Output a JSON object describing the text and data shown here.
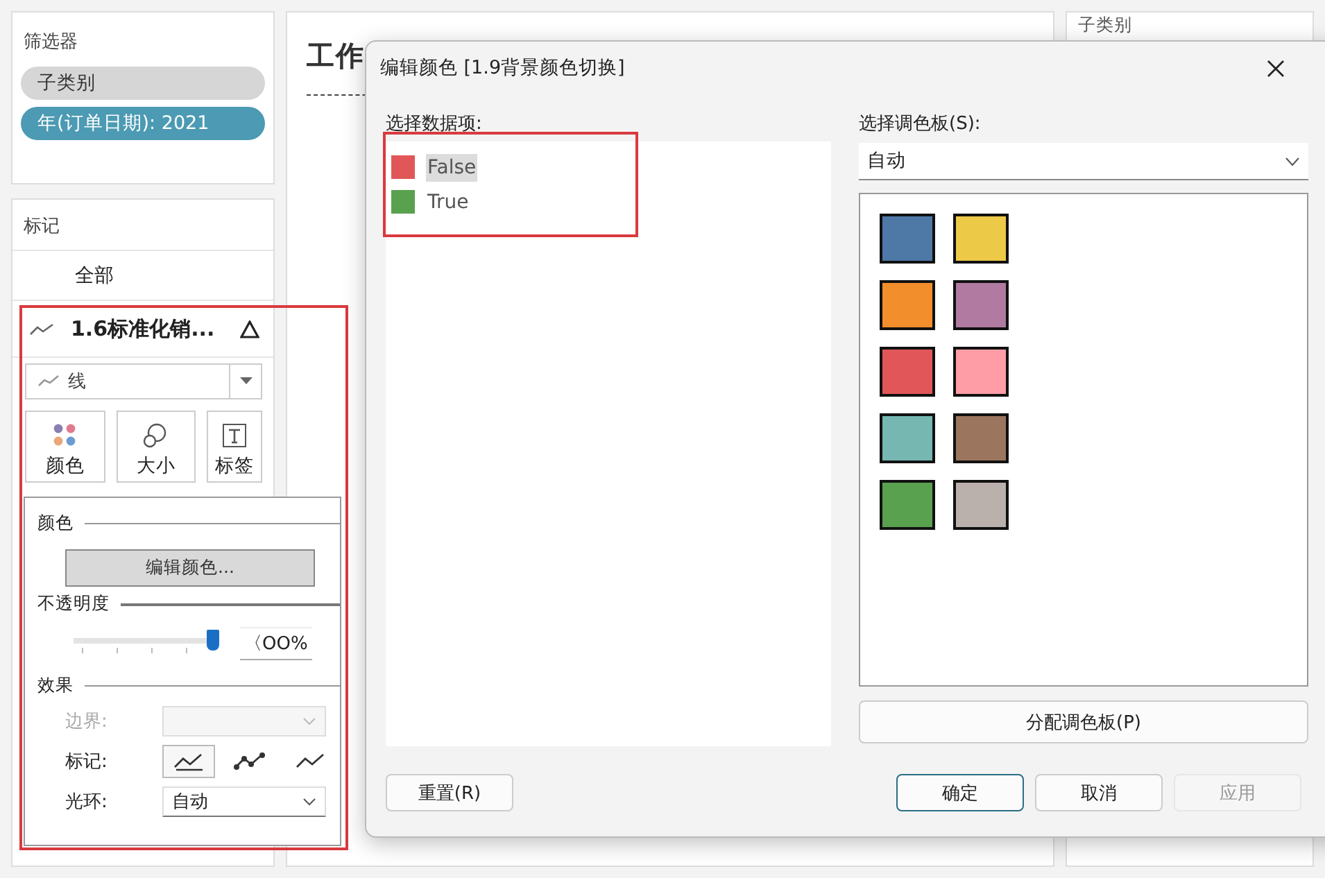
{
  "filters": {
    "title": "筛选器",
    "pills": [
      {
        "label": "子类别",
        "kind": "dimension"
      },
      {
        "label": "年(订单日期): 2021",
        "kind": "date"
      }
    ]
  },
  "marks": {
    "title": "标记",
    "all_label": "全部",
    "layer": {
      "name": "1.6标准化销..."
    },
    "mark_type": "线",
    "buttons": [
      {
        "label": "颜色",
        "kind": "color"
      },
      {
        "label": "大小",
        "kind": "size"
      },
      {
        "label": "标签",
        "kind": "label"
      }
    ]
  },
  "canvas": {
    "title": "工作"
  },
  "right_panel": {
    "title": "子类别"
  },
  "color_popup": {
    "color_label": "颜色",
    "edit_button": "编辑颜色...",
    "opacity_label": "不透明度",
    "opacity_slider": {
      "level": 1
    },
    "opacity_value": "〈OO%",
    "effects_label": "效果",
    "border": {
      "label": "边界:",
      "disabled": true
    },
    "marker": {
      "label": "标记:",
      "options": [
        {
          "kind": "none",
          "selected": true
        },
        {
          "kind": "all",
          "selected": false
        },
        {
          "kind": "auto",
          "selected": false
        }
      ]
    },
    "halo": {
      "label": "光环:",
      "value": "自动"
    }
  },
  "dialog": {
    "title": "编辑颜色 [1.9背景颜色切换]",
    "data_label": "选择数据项:",
    "items": [
      {
        "label": "False",
        "color": "#e15759",
        "selected": true
      },
      {
        "label": "True",
        "color": "#59a14f",
        "selected": false
      }
    ],
    "palette_label": "选择调色板(S):",
    "palette_value": "自动",
    "swatches": [
      {
        "color": "#4e79a7"
      },
      {
        "color": "#edc948"
      },
      {
        "color": "#f28e2b"
      },
      {
        "color": "#b07aa1"
      },
      {
        "color": "#e15759"
      },
      {
        "color": "#ff9da7"
      },
      {
        "color": "#76b7b2"
      },
      {
        "color": "#9c755f"
      },
      {
        "color": "#59a14f"
      },
      {
        "color": "#bab0ac"
      }
    ],
    "assign_button": "分配调色板(P)",
    "buttons": [
      {
        "label": "重置(R)",
        "kind": "reset",
        "disabled": false
      },
      {
        "label": "确定",
        "kind": "default",
        "disabled": false
      },
      {
        "label": "取消",
        "kind": "normal",
        "disabled": false
      },
      {
        "label": "应用",
        "kind": "normal",
        "disabled": true
      }
    ]
  }
}
